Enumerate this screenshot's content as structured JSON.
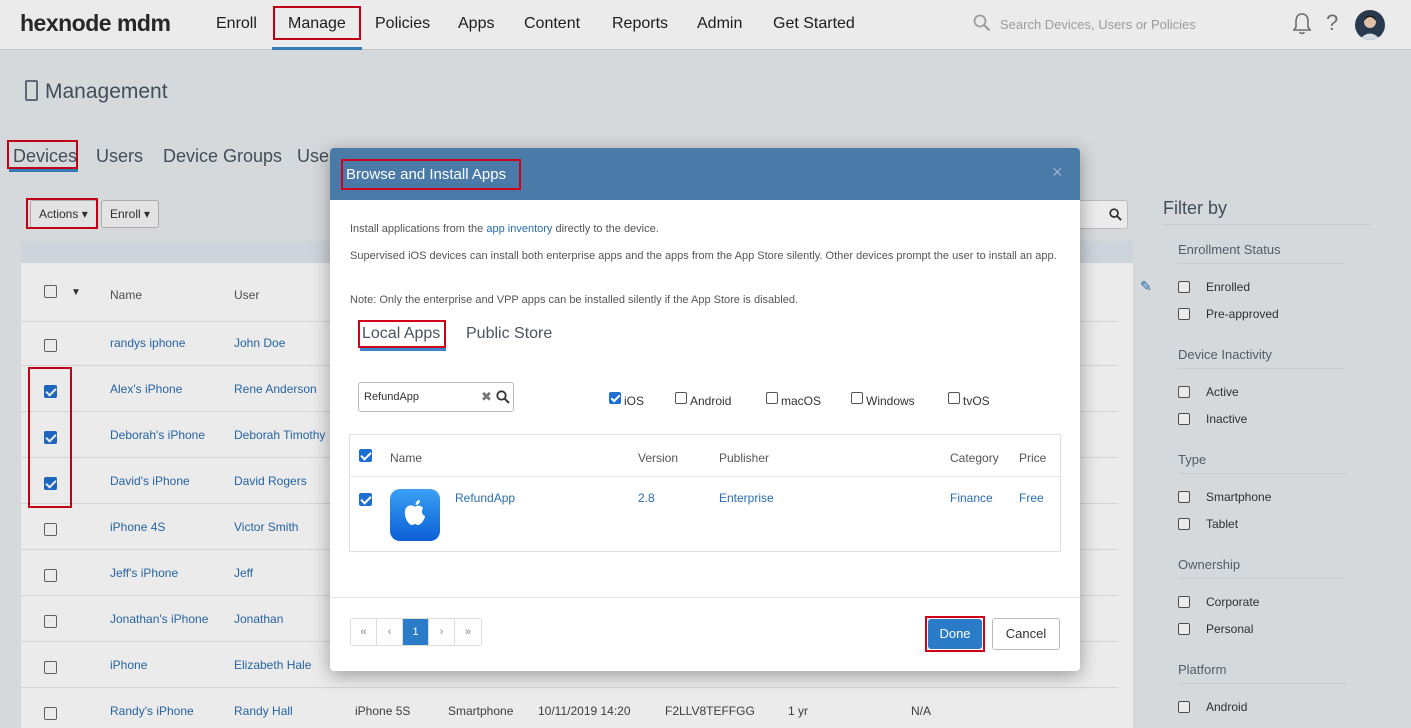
{
  "logo": "hexnode mdm",
  "nav": {
    "items": [
      "Enroll",
      "Manage",
      "Policies",
      "Apps",
      "Content",
      "Reports",
      "Admin",
      "Get Started"
    ],
    "search_placeholder": "Search Devices, Users or Policies",
    "help": "?"
  },
  "page": {
    "title": "Management",
    "tabs": [
      "Devices",
      "Users",
      "Device Groups",
      "User"
    ],
    "actions_label": "Actions",
    "enroll_label": "Enroll"
  },
  "table": {
    "headers": [
      "Name",
      "User"
    ],
    "rows": [
      {
        "name": "randys iphone",
        "user": "John Doe",
        "checked": false
      },
      {
        "name": "Alex's iPhone",
        "user": "Rene Anderson",
        "checked": true
      },
      {
        "name": "Deborah's iPhone",
        "user": "Deborah Timothy",
        "checked": true
      },
      {
        "name": "David's iPhone",
        "user": "David Rogers",
        "checked": true
      },
      {
        "name": "iPhone 4S",
        "user": "Victor Smith",
        "checked": false
      },
      {
        "name": "Jeff's iPhone",
        "user": "Jeff",
        "checked": false
      },
      {
        "name": "Jonathan's iPhone",
        "user": "Jonathan",
        "checked": false
      },
      {
        "name": "iPhone",
        "user": "Elizabeth Hale",
        "checked": false
      },
      {
        "name": "Randy's iPhone",
        "user": "Randy Hall",
        "checked": false,
        "model": "iPhone 5S",
        "type": "Smartphone",
        "date": "10/11/2019 14:20",
        "serial": "F2LLV8TEFFGG",
        "age": "1 yr",
        "extra": "N/A"
      }
    ]
  },
  "filter": {
    "title": "Filter by",
    "sections": [
      {
        "title": "Enrollment Status",
        "options": [
          "Enrolled",
          "Pre-approved"
        ]
      },
      {
        "title": "Device Inactivity",
        "options": [
          "Active",
          "Inactive"
        ]
      },
      {
        "title": "Type",
        "options": [
          "Smartphone",
          "Tablet"
        ]
      },
      {
        "title": "Ownership",
        "options": [
          "Corporate",
          "Personal"
        ]
      },
      {
        "title": "Platform",
        "options": [
          "Android"
        ]
      }
    ]
  },
  "modal": {
    "title": "Browse and Install Apps",
    "close": "×",
    "intro_before": "Install applications from the ",
    "intro_link": "app inventory",
    "intro_after": " directly to the device.",
    "para2": "Supervised iOS devices can install both enterprise apps and the apps from the App Store silently. Other devices prompt the user to install an app.",
    "note": "Note: Only the enterprise and VPP apps can be installed silently if the App Store is disabled.",
    "tabs": [
      "Local Apps",
      "Public Store"
    ],
    "search_value": "RefundApp",
    "os_filters": [
      {
        "label": "iOS",
        "checked": true
      },
      {
        "label": "Android",
        "checked": false
      },
      {
        "label": "macOS",
        "checked": false
      },
      {
        "label": "Windows",
        "checked": false
      },
      {
        "label": "tvOS",
        "checked": false
      }
    ],
    "app_headers": [
      "Name",
      "Version",
      "Publisher",
      "Category",
      "Price"
    ],
    "apps": [
      {
        "name": "RefundApp",
        "version": "2.8",
        "publisher": "Enterprise",
        "category": "Finance",
        "price": "Free",
        "checked": true
      }
    ],
    "pager": [
      "«",
      "‹",
      "1",
      "›",
      "»"
    ],
    "done": "Done",
    "cancel": "Cancel"
  },
  "colors": {
    "accent": "#2a7cc9",
    "modal_header": "#4a7aa7",
    "highlight": "#d0021b"
  }
}
